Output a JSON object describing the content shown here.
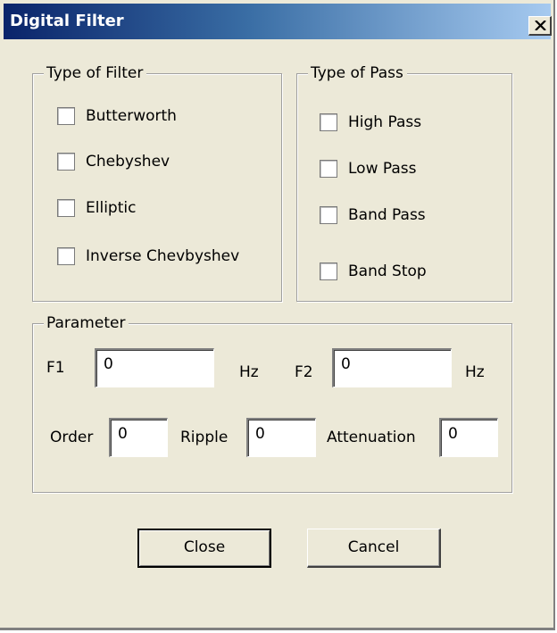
{
  "window": {
    "title": "Digital Filter"
  },
  "filter_type": {
    "legend": "Type of Filter",
    "options": [
      {
        "label": "Butterworth",
        "checked": false
      },
      {
        "label": "Chebyshev",
        "checked": false
      },
      {
        "label": "Elliptic",
        "checked": false
      },
      {
        "label": "Inverse Chevbyshev",
        "checked": false
      }
    ]
  },
  "pass_type": {
    "legend": "Type of Pass",
    "options": [
      {
        "label": "High Pass",
        "checked": false
      },
      {
        "label": "Low Pass",
        "checked": false
      },
      {
        "label": "Band Pass",
        "checked": false
      },
      {
        "label": "Band Stop",
        "checked": false
      }
    ]
  },
  "parameter": {
    "legend": "Parameter",
    "f1_label": "F1",
    "f1_value": "0",
    "f1_unit": "Hz",
    "f2_label": "F2",
    "f2_value": "0",
    "f2_unit": "Hz",
    "order_label": "Order",
    "order_value": "0",
    "ripple_label": "Ripple",
    "ripple_value": "0",
    "attenuation_label": "Attenuation",
    "attenuation_value": "0"
  },
  "buttons": {
    "close_label": "Close",
    "cancel_label": "Cancel"
  },
  "icons": {
    "titlebar_close": "close-icon"
  },
  "colors": {
    "dialog_background": "#ece9d8",
    "title_gradient_start": "#0a246a",
    "title_gradient_end": "#a6caf0"
  }
}
